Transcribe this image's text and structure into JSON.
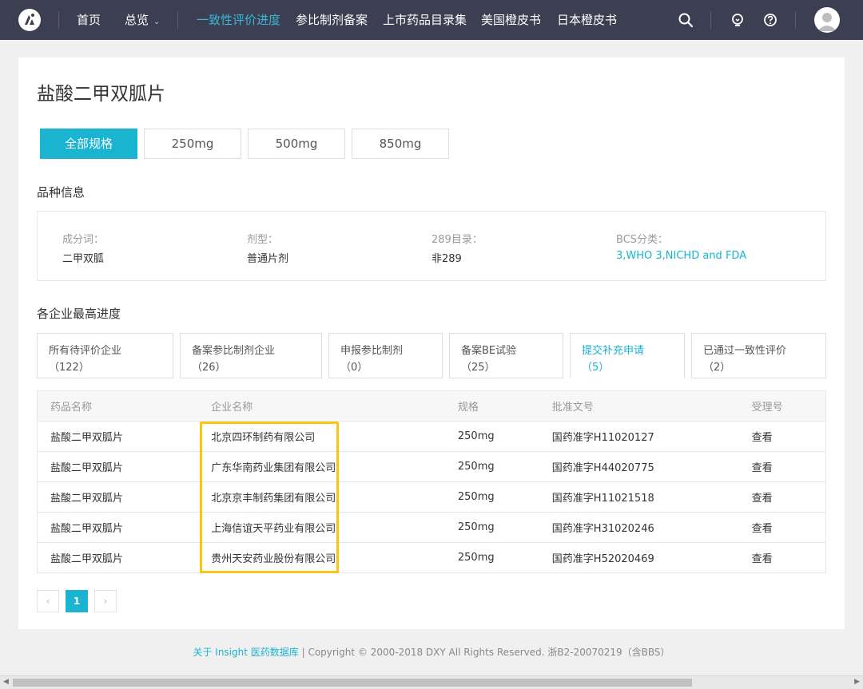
{
  "nav": {
    "items": [
      {
        "label": "首页",
        "active": false
      },
      {
        "label": "总览",
        "active": false,
        "caret": "⌄"
      },
      {
        "label": "一致性评价进度",
        "active": true
      },
      {
        "label": "参比制剂备案",
        "active": false
      },
      {
        "label": "上市药品目录集",
        "active": false
      },
      {
        "label": "美国橙皮书",
        "active": false
      },
      {
        "label": "日本橙皮书",
        "active": false
      }
    ],
    "icons": [
      "search-icon",
      "lightbulb-icon",
      "help-icon",
      "user-avatar"
    ]
  },
  "drug": {
    "title": "盐酸二甲双胍片"
  },
  "spec_tabs": [
    "全部规格",
    "250mg",
    "500mg",
    "850mg"
  ],
  "variety": {
    "section_title": "品种信息",
    "fields": [
      {
        "label": "成分词：",
        "value": "二甲双胍"
      },
      {
        "label": "剂型：",
        "value": "普通片剂"
      },
      {
        "label": "289目录：",
        "value": "非289"
      },
      {
        "label": "BCS分类：",
        "value": "3,WHO 3,NICHD and FDA"
      }
    ]
  },
  "progress": {
    "section_title": "各企业最高进度",
    "tabs": [
      {
        "label": "所有待评价企业",
        "count": "（122）"
      },
      {
        "label": "备案参比制剂企业",
        "count": "（26）"
      },
      {
        "label": "申报参比制剂",
        "count": "（0）"
      },
      {
        "label": "备案BE试验",
        "count": "（25）"
      },
      {
        "label": "提交补充申请",
        "count": "（5）"
      },
      {
        "label": "已通过一致性评价",
        "count": "（2）"
      }
    ]
  },
  "table": {
    "headers": [
      "药品名称",
      "企业名称",
      "规格",
      "批准文号",
      "受理号"
    ],
    "rows": [
      [
        "盐酸二甲双胍片",
        "北京四环制药有限公司",
        "250mg",
        "国药准字H11020127",
        "查看"
      ],
      [
        "盐酸二甲双胍片",
        "广东华南药业集团有限公司",
        "250mg",
        "国药准字H44020775",
        "查看"
      ],
      [
        "盐酸二甲双胍片",
        "北京京丰制药集团有限公司",
        "250mg",
        "国药准字H11021518",
        "查看"
      ],
      [
        "盐酸二甲双胍片",
        "上海信谊天平药业有限公司",
        "250mg",
        "国药准字H31020246",
        "查看"
      ],
      [
        "盐酸二甲双胍片",
        "贵州天安药业股份有限公司",
        "250mg",
        "国药准字H52020469",
        "查看"
      ]
    ]
  },
  "pager": {
    "prev": "‹",
    "current": "1",
    "next": "›"
  },
  "footer": {
    "link": "关于 Insight 医药数据库",
    "sep": " | ",
    "copyright": "Copyright © 2000-2018 DXY All Rights Reserved. 浙B2-20070219（含BBS）"
  },
  "colors": {
    "accent": "#1ab3d0",
    "nav_bg": "#3c3f51",
    "highlight": "#f7c518"
  }
}
